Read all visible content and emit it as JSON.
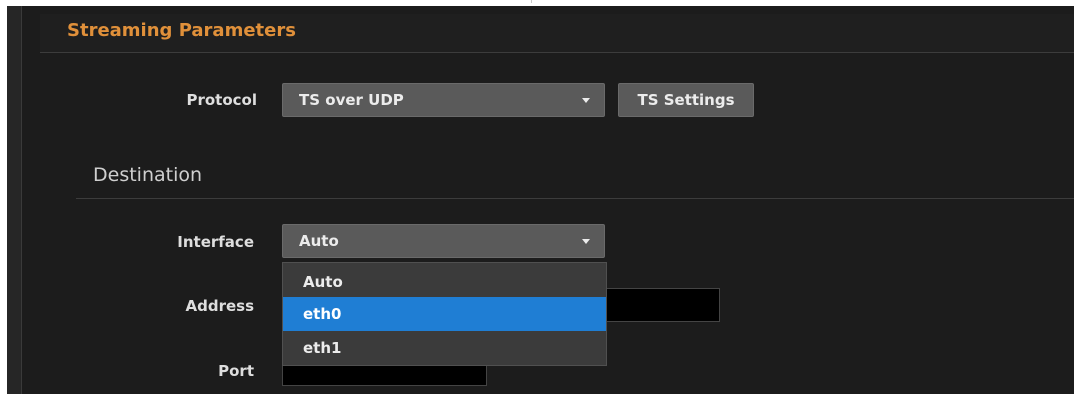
{
  "section": {
    "title": "Streaming Parameters"
  },
  "protocol": {
    "label": "Protocol",
    "selected": "TS over UDP",
    "settings_button": "TS Settings"
  },
  "destination": {
    "title": "Destination",
    "interface": {
      "label": "Interface",
      "selected": "Auto",
      "options": [
        "Auto",
        "eth0",
        "eth1"
      ],
      "highlighted_option": "eth0"
    },
    "address": {
      "label": "Address",
      "value": ""
    },
    "port": {
      "label": "Port",
      "value": ""
    }
  },
  "colors": {
    "accent": "#e0903a",
    "highlight": "#1f7ed4",
    "background": "#1c1c1c"
  }
}
